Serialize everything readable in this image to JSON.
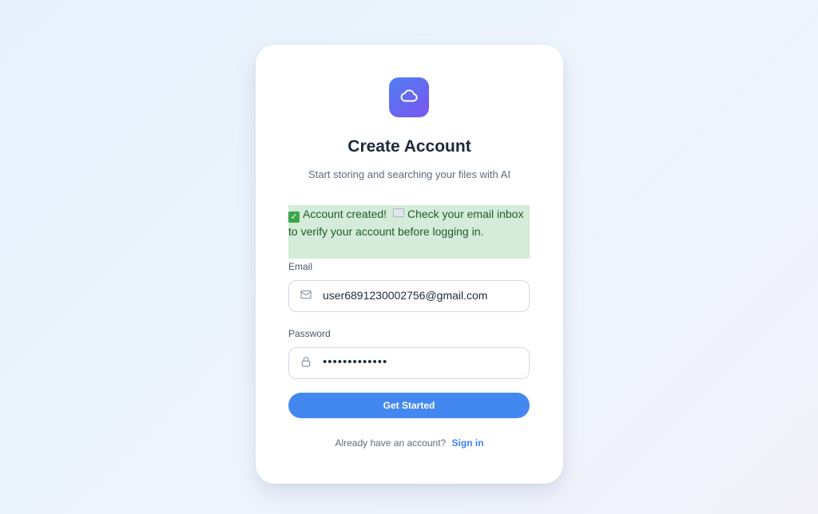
{
  "brand": {
    "icon": "cloud-icon",
    "accent": "#4388f0",
    "logo_gradient": [
      "#4f7ff4",
      "#7a55ee"
    ]
  },
  "header": {
    "title": "Create Account",
    "subtitle": "Start storing and searching your files with AI"
  },
  "alert": {
    "part1": "Account created!",
    "part2": "Check your email inbox to verify your account before logging in.",
    "background": "#d5ecd8"
  },
  "form": {
    "email_label": "Email",
    "email_value": "user6891230002756@gmail.com",
    "email_icon": "mail-icon",
    "password_label": "Password",
    "password_value": "•••••••••••••",
    "password_icon": "lock-icon",
    "submit_label": "Get Started"
  },
  "footer": {
    "prompt": "Already have an account?",
    "link": "Sign in"
  }
}
